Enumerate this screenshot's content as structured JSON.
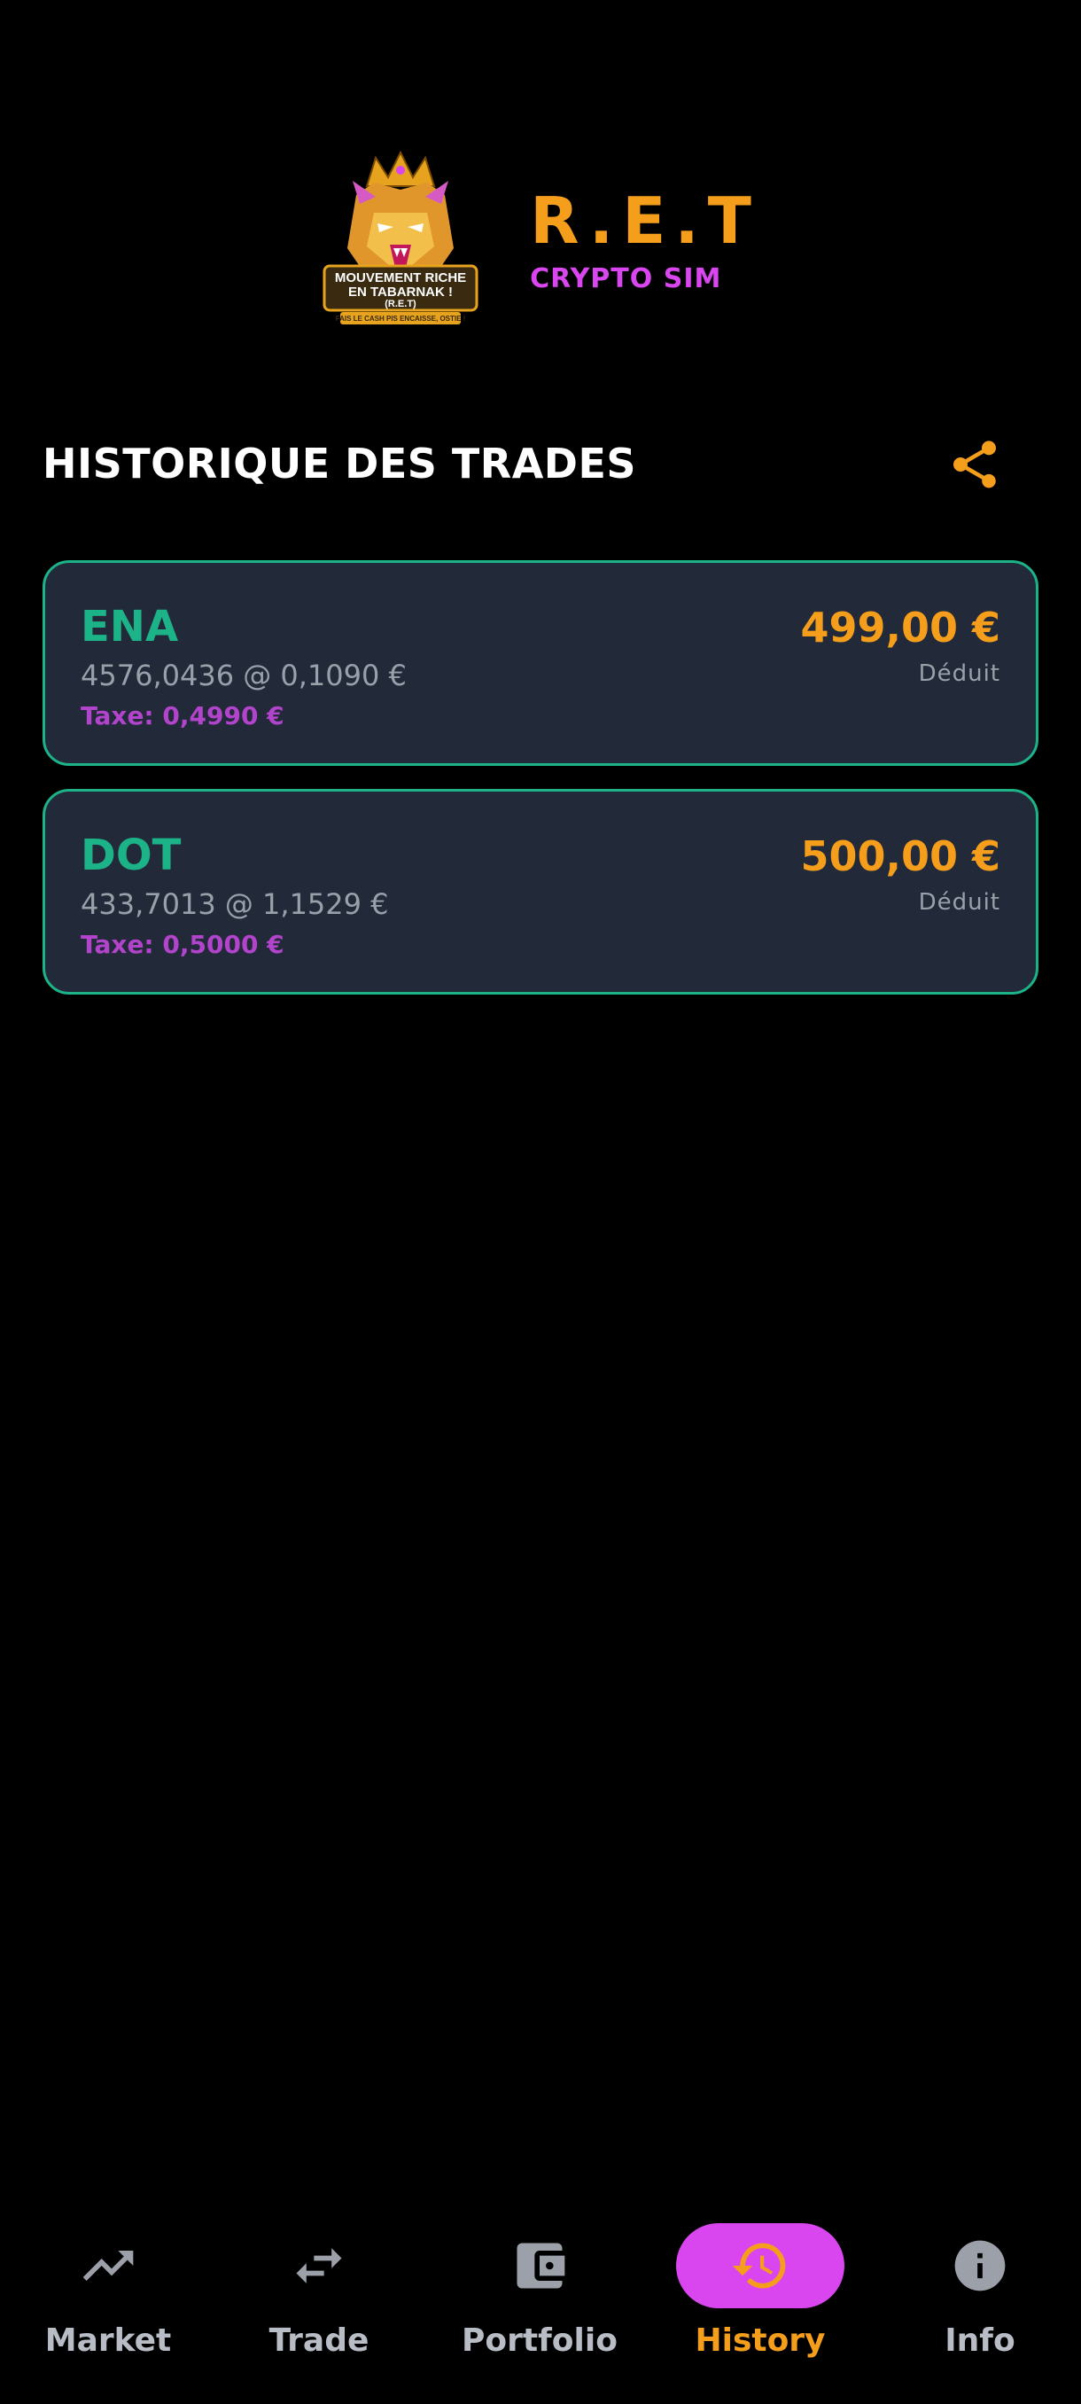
{
  "header": {
    "title": "R.E.T",
    "subtitle": "CRYPTO SIM",
    "logo_text_1": "MOUVEMENT RICHE",
    "logo_text_2": "EN TABARNAK !",
    "logo_text_3": "(R.E.T)",
    "logo_text_4": "FAIS LE CASH PIS ENCAISSE, OSTIE !"
  },
  "section": {
    "title": "HISTORIQUE DES TRADES",
    "share_icon": "share-icon"
  },
  "trades": [
    {
      "coin": "ENA",
      "detail": "4576,0436 @ 0,1090 €",
      "tax": "Taxe: 0,4990 €",
      "amount": "499,00 €",
      "status": "Déduit"
    },
    {
      "coin": "DOT",
      "detail": "433,7013 @ 1,1529 €",
      "tax": "Taxe: 0,5000 €",
      "amount": "500,00 €",
      "status": "Déduit"
    }
  ],
  "nav": {
    "items": [
      {
        "label": "Market",
        "icon": "trending-up-icon",
        "active": false
      },
      {
        "label": "Trade",
        "icon": "swap-icon",
        "active": false
      },
      {
        "label": "Portfolio",
        "icon": "wallet-icon",
        "active": false
      },
      {
        "label": "History",
        "icon": "history-icon",
        "active": true
      },
      {
        "label": "Info",
        "icon": "info-icon",
        "active": false
      }
    ]
  },
  "colors": {
    "accent_orange": "#F59E1B",
    "accent_magenta": "#D946EF",
    "accent_green": "#1DB388",
    "card_bg": "#222A3A",
    "background": "#000000"
  }
}
